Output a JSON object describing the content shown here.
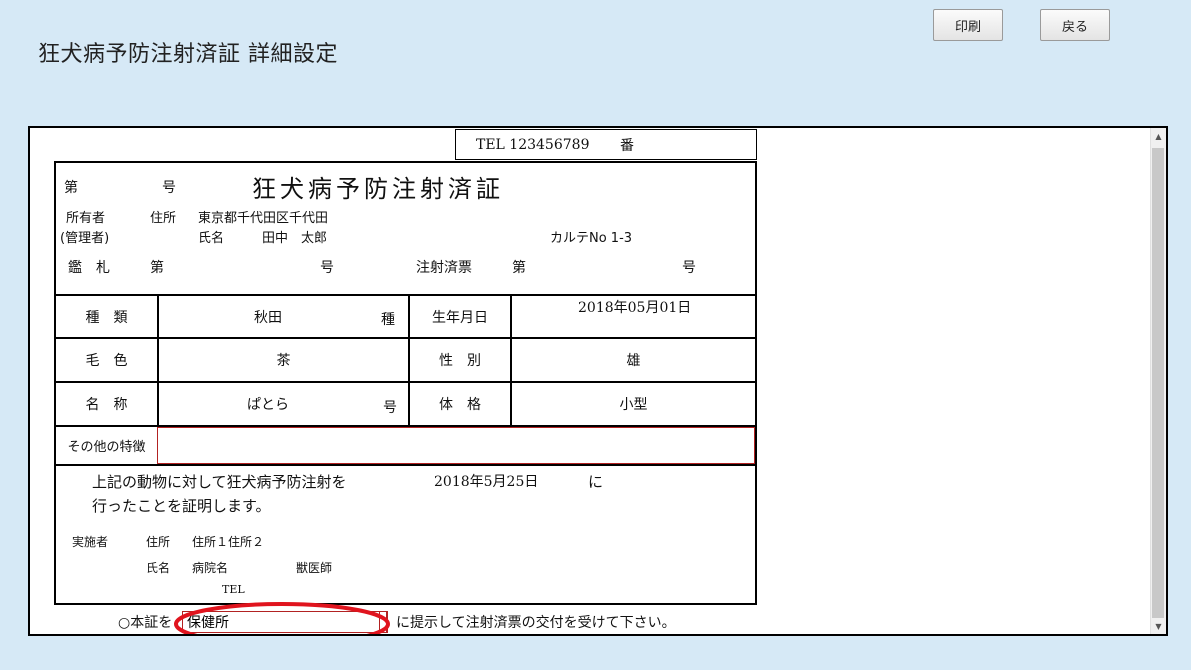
{
  "page": {
    "title": "狂犬病予防注射済証 詳細設定"
  },
  "toolbar": {
    "print_label": "印刷",
    "back_label": "戻る"
  },
  "certificate": {
    "tel_line": "TEL 123456789",
    "tel_suffix": "番",
    "number_label": "第",
    "number_suffix": "号",
    "title": "狂犬病予防注射済証",
    "owner_label": "所有者",
    "owner_sub_label": "(管理者)",
    "address_label": "住所",
    "address_value": "東京都千代田区千代田",
    "name_label": "氏名",
    "name_value": "田中　太郎",
    "chart_no": "カルテNo 1-3",
    "tag_label": "鑑　札",
    "tag_dai": "第",
    "tag_go": "号",
    "ticket_label": "注射済票",
    "ticket_dai": "第",
    "ticket_go": "号",
    "breed_label": "種　類",
    "breed_value": "秋田",
    "breed_suffix": "種",
    "birth_label": "生年月日",
    "birth_value": "2018年05月01日",
    "color_label": "毛　色",
    "color_value": "茶",
    "sex_label": "性　別",
    "sex_value": "雄",
    "dog_name_label": "名　称",
    "dog_name_value": "ぱとら",
    "dog_name_suffix": "号",
    "size_label": "体　格",
    "size_value": "小型",
    "other_label": "その他の特徴",
    "other_value": "",
    "statement_1": "上記の動物に対して狂犬病予防注射を",
    "statement_date": "2018年5月25日",
    "statement_ni": "に",
    "statement_2": "行ったことを証明します。",
    "performer_label": "実施者",
    "performer_address_label": "住所",
    "performer_address_value": "住所１住所２",
    "performer_name_label": "氏名",
    "performer_clinic": "病院名",
    "performer_vet": "獣医師",
    "performer_tel": "TEL"
  },
  "footer": {
    "prefix": "○本証を",
    "destination_value": "保健所",
    "suffix": "に提示して注射済票の交付を受けて下さい。"
  },
  "annotation": {
    "color": "#e0141e"
  }
}
